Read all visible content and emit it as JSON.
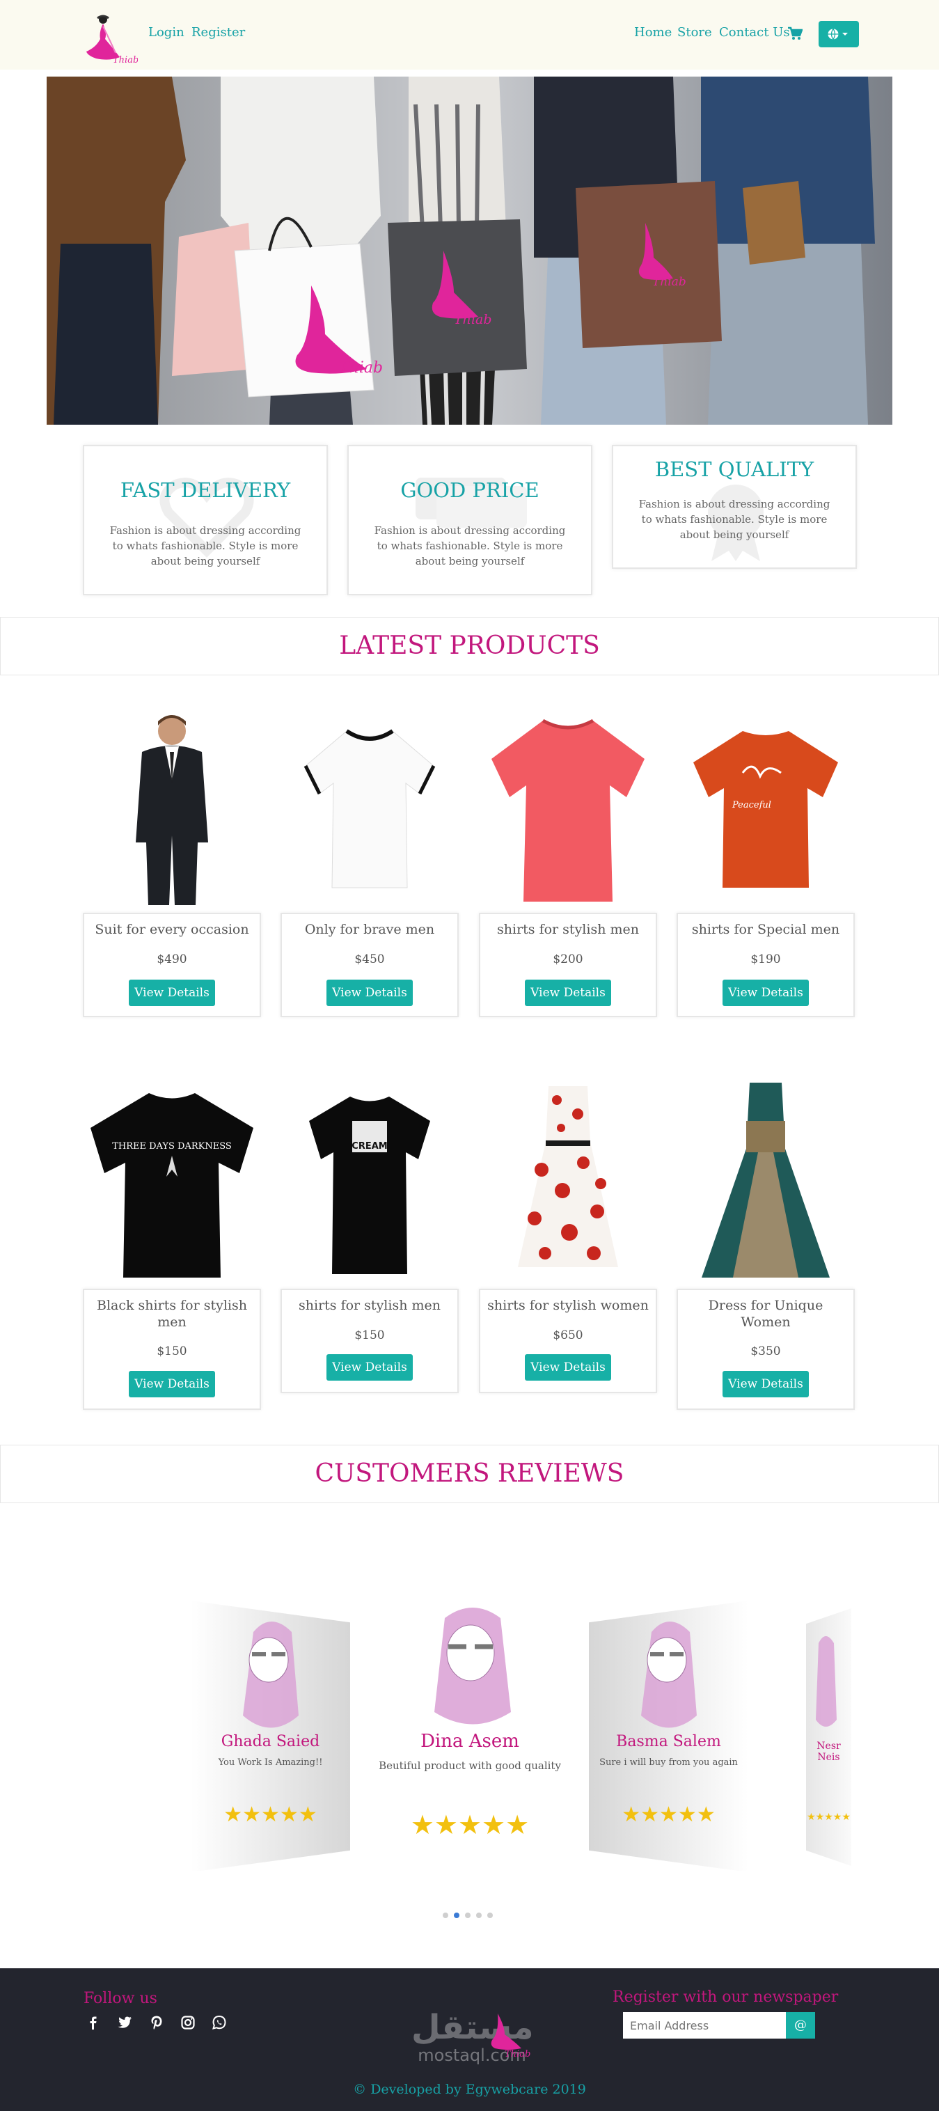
{
  "brand": {
    "name": "Thiab"
  },
  "nav": {
    "left": [
      {
        "label": "Login"
      },
      {
        "label": "Register"
      }
    ],
    "right": [
      {
        "label": "Home"
      },
      {
        "label": "Store"
      },
      {
        "label": "Contact Us"
      }
    ],
    "cart_icon": "shopping-cart-icon",
    "language_icon": "globe-icon"
  },
  "features": [
    {
      "title": "FAST DELIVERY",
      "text": "Fashion is about dressing according to whats fashionable. Style is more about being yourself"
    },
    {
      "title": "GOOD PRICE",
      "text": "Fashion is about dressing according to whats fashionable. Style is more about being yourself"
    },
    {
      "title": "BEST QUALITY",
      "text": "Fashion is about dressing according to whats fashionable. Style is more about being yourself"
    }
  ],
  "latest_products": {
    "title": "LATEST PRODUCTS",
    "button_label": "View Details",
    "items": [
      {
        "name": "Suit for every occasion",
        "price": "$490"
      },
      {
        "name": "Only for brave men",
        "price": "$450"
      },
      {
        "name": "shirts for stylish men",
        "price": "$200"
      },
      {
        "name": "shirts for Special men",
        "price": "$190"
      },
      {
        "name": "Black shirts for stylish men",
        "price": "$150"
      },
      {
        "name": "shirts for stylish men",
        "price": "$150"
      },
      {
        "name": "shirts for stylish women",
        "price": "$650"
      },
      {
        "name": "Dress for Unique Women",
        "price": "$350"
      }
    ]
  },
  "reviews": {
    "title": "CUSTOMERS REVIEWS",
    "items": [
      {
        "name": "Ghada Saied",
        "text": "You Work Is Amazing!!",
        "rating": 5
      },
      {
        "name": "Dina Asem",
        "text": "Beutiful product with good quality",
        "rating": 5
      },
      {
        "name": "Basma Salem",
        "text": "Sure i will buy from you again",
        "rating": 5
      },
      {
        "name": "Nesr Neis",
        "text": "",
        "rating": 5
      }
    ],
    "stars": "★★★★★",
    "active_dot": 1
  },
  "footer": {
    "follow_title": "Follow us",
    "social_icons": [
      "facebook-icon",
      "twitter-icon",
      "pinterest-icon",
      "instagram-icon",
      "whatsapp-icon"
    ],
    "newsletter_title": "Register with our newspaper",
    "email_placeholder": "Email Address",
    "submit_symbol": "@",
    "watermark_text": "mostaql.com",
    "copyright": "© Developed by Egywebcare 2019"
  },
  "colors": {
    "accent": "#17b0a6",
    "brand": "#c2177d",
    "footer_bg": "#23252e",
    "navbar_bg": "#fbfaf0"
  }
}
